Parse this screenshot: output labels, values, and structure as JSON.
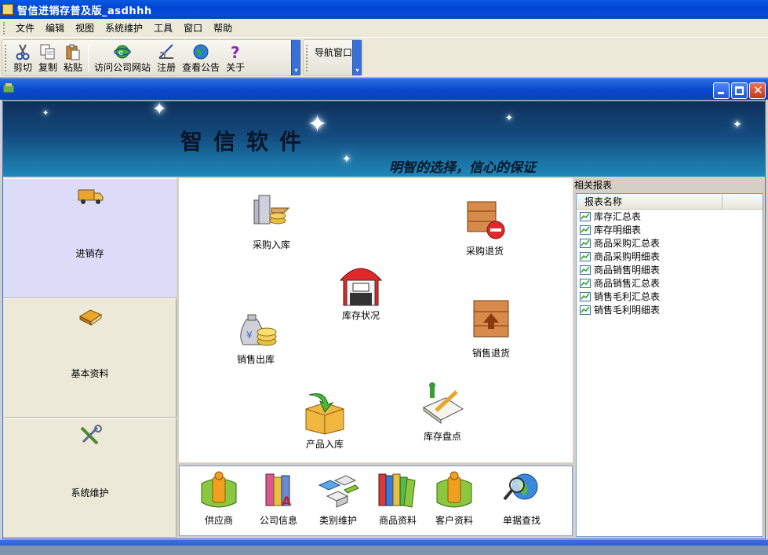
{
  "window": {
    "title": "智信进销存普及版_asdhhh"
  },
  "menu": [
    "文件",
    "编辑",
    "视图",
    "系统维护",
    "工具",
    "窗口",
    "帮助"
  ],
  "toolbar": {
    "buttons": [
      {
        "label": "剪切",
        "icon": "scissors-icon"
      },
      {
        "label": "复制",
        "icon": "copy-icon"
      },
      {
        "label": "粘贴",
        "icon": "paste-icon"
      },
      {
        "label": "访问公司网站",
        "icon": "web-icon"
      },
      {
        "label": "注册",
        "icon": "register-icon"
      },
      {
        "label": "查看公告",
        "icon": "globe-icon"
      },
      {
        "label": "关于",
        "icon": "help-icon"
      }
    ],
    "nav_window": "导航窗口"
  },
  "banner": {
    "brand": "智信软件",
    "slogan": "明智的选择，信心的保证"
  },
  "leftnav": [
    {
      "label": "进销存",
      "icon": "truck-icon",
      "active": true
    },
    {
      "label": "基本资料",
      "icon": "book-icon",
      "active": false
    },
    {
      "label": "系统维护",
      "icon": "tools-icon",
      "active": false
    }
  ],
  "features": {
    "purchase_in": "采购入库",
    "purchase_return": "采购退货",
    "stock_status": "库存状况",
    "sales_out": "销售出库",
    "sales_return": "销售退货",
    "product_in": "产品入库",
    "stock_check": "库存盘点"
  },
  "bottom": [
    "供应商",
    "公司信息",
    "类别维护",
    "商品资料",
    "客户资料",
    "单据查找"
  ],
  "reports": {
    "panel_title": "相关报表",
    "column": "报表名称",
    "items": [
      "库存汇总表",
      "库存明细表",
      "商品采购汇总表",
      "商品采购明细表",
      "商品销售明细表",
      "商品销售汇总表",
      "销售毛利汇总表",
      "销售毛利明细表"
    ]
  },
  "colors": {
    "title_blue": "#0046d4",
    "banner_dark": "#0f2f5a",
    "nav_active": "#dcdcf8"
  }
}
